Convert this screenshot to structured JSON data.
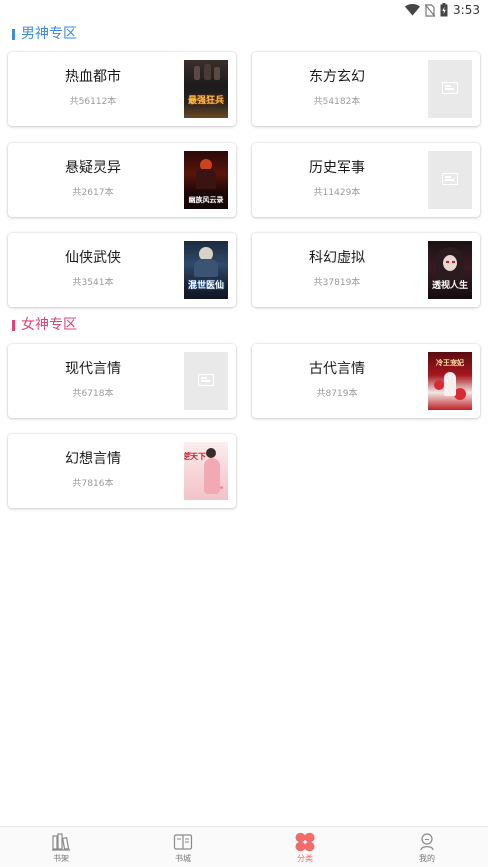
{
  "status_bar": {
    "time": "3:53",
    "icons": [
      "wifi-icon",
      "no-sim-icon",
      "battery-charging-icon"
    ]
  },
  "colors": {
    "male_section": "#3d8be0",
    "female_section": "#e0437a",
    "nav_active": "#f26b6b",
    "nav_inactive": "#9a9a9a"
  },
  "sections": [
    {
      "title": "男神专区",
      "categories": [
        {
          "name": "热血都市",
          "count": "共56112本",
          "cover_text": "最强狂兵"
        },
        {
          "name": "东方玄幻",
          "count": "共54182本",
          "cover_text": ""
        },
        {
          "name": "悬疑灵异",
          "count": "共2617本",
          "cover_text": "幽族风云录"
        },
        {
          "name": "历史军事",
          "count": "共11429本",
          "cover_text": ""
        },
        {
          "name": "仙侠武侠",
          "count": "共3541本",
          "cover_text": "混世医仙"
        },
        {
          "name": "科幻虚拟",
          "count": "共37819本",
          "cover_text": "透视人生"
        }
      ]
    },
    {
      "title": "女神专区",
      "categories": [
        {
          "name": "现代言情",
          "count": "共6718本",
          "cover_text": ""
        },
        {
          "name": "古代言情",
          "count": "共8719本",
          "cover_text": "冷王宠妃"
        },
        {
          "name": "幻想言情",
          "count": "共7816本",
          "cover_text": "凤逆天下"
        }
      ]
    }
  ],
  "bottom_nav": [
    {
      "label": "书架",
      "icon": "bookshelf-icon",
      "active": false
    },
    {
      "label": "书城",
      "icon": "bookstore-icon",
      "active": false
    },
    {
      "label": "分类",
      "icon": "category-icon",
      "active": true
    },
    {
      "label": "我的",
      "icon": "profile-icon",
      "active": false
    }
  ]
}
